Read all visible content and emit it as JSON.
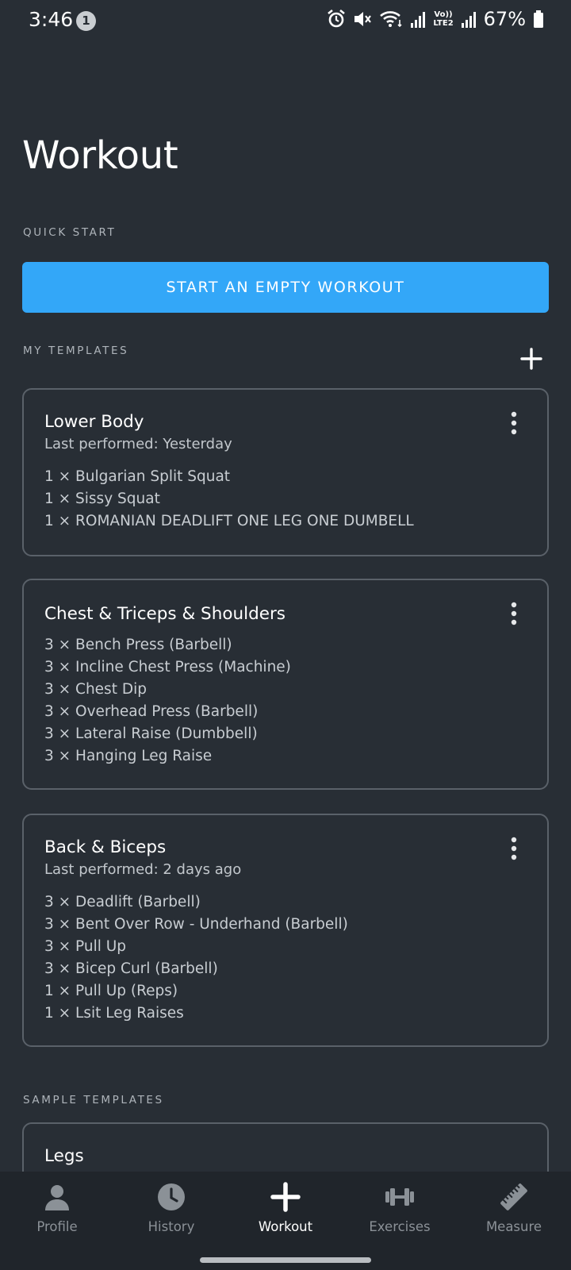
{
  "status_bar": {
    "time": "3:46",
    "notification_count": "1",
    "signal_label_top": "Vo))",
    "signal_label_bottom": "LTE2",
    "battery_percent": "67%",
    "icons": [
      "alarm-icon",
      "mute-icon",
      "wifi-icon",
      "signal-icon",
      "signal-icon",
      "battery-icon"
    ]
  },
  "header": {
    "title": "Workout"
  },
  "quick_start": {
    "label": "QUICK START",
    "button_label": "START AN EMPTY WORKOUT"
  },
  "my_templates": {
    "label": "MY TEMPLATES",
    "add_icon": "plus-icon",
    "cards": [
      {
        "title": "Lower Body",
        "last_performed": "Last performed: Yesterday",
        "exercises": [
          "1 × Bulgarian Split Squat",
          "1 × Sissy Squat",
          "1 × ROMANIAN DEADLIFT ONE LEG ONE DUMBELL"
        ]
      },
      {
        "title": "Chest & Triceps & Shoulders",
        "exercises": [
          "3 × Bench Press (Barbell)",
          "3 × Incline Chest Press (Machine)",
          "3 × Chest Dip",
          "3 × Overhead Press (Barbell)",
          "3 × Lateral Raise (Dumbbell)",
          "3 × Hanging Leg Raise"
        ]
      },
      {
        "title": "Back & Biceps",
        "last_performed": "Last performed: 2 days ago",
        "exercises": [
          "3 × Deadlift (Barbell)",
          "3 × Bent Over Row - Underhand (Barbell)",
          "3 × Pull Up",
          "3 × Bicep Curl (Barbell)",
          "1 × Pull Up (Reps)",
          "1 × Lsit Leg Raises"
        ]
      }
    ]
  },
  "sample_templates": {
    "label": "SAMPLE TEMPLATES",
    "cards": [
      {
        "title": "Legs"
      }
    ]
  },
  "bottom_nav": {
    "items": [
      {
        "label": "Profile",
        "icon": "person-icon"
      },
      {
        "label": "History",
        "icon": "clock-icon"
      },
      {
        "label": "Workout",
        "icon": "plus-icon",
        "active": true
      },
      {
        "label": "Exercises",
        "icon": "dumbbell-icon"
      },
      {
        "label": "Measure",
        "icon": "ruler-icon"
      }
    ]
  },
  "colors": {
    "background": "#282e35",
    "accent": "#33a7f8",
    "card_border": "#5a6169",
    "nav_background": "#20252b"
  }
}
